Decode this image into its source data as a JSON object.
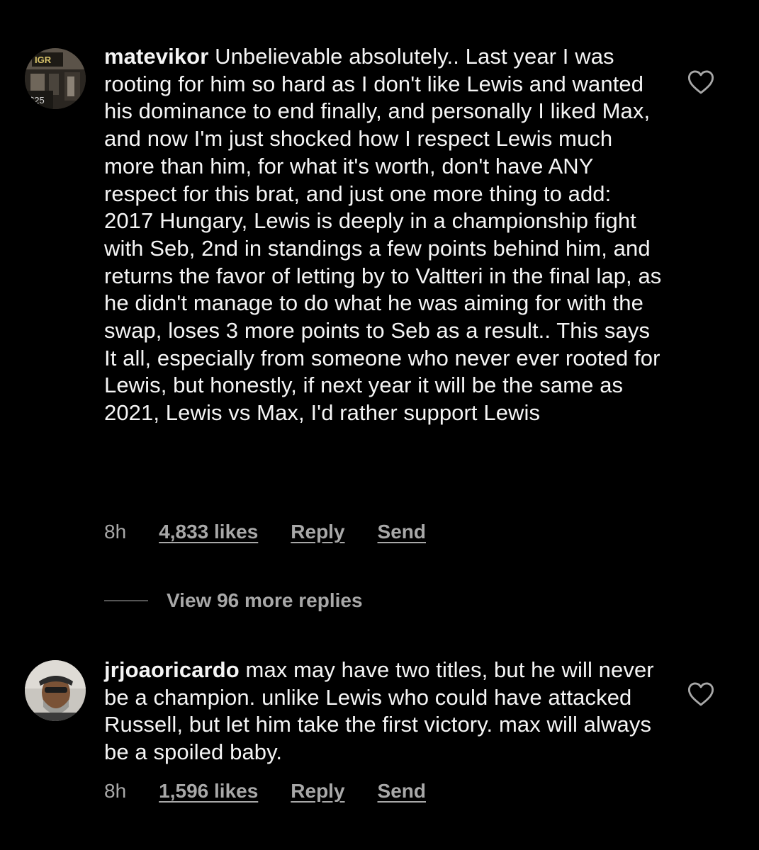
{
  "comments": [
    {
      "username": "matevikor",
      "text": "Unbelievable absolutely.. Last year I was rooting for him so hard as I don't like Lewis and wanted his dominance to end finally, and personally I liked Max, and now I'm just shocked how I respect Lewis much more than him, for what it's worth, don't have ANY respect for this brat, and just one more thing to add: 2017 Hungary, Lewis is deeply in a championship fight with Seb, 2nd in standings a few points behind him, and returns the favor of letting by to Valtteri in the final lap, as he didn't manage to do what he was aiming for with the swap, loses 3 more points to Seb as a result.. This says It all, especially from someone who never ever rooted for Lewis, but honestly, if next year it will be the same as 2021, Lewis vs Max, I'd rather support Lewis",
      "time": "8h",
      "likes": "4,833 likes",
      "reply_label": "Reply",
      "send_label": "Send",
      "avatar_sign_text": "IGR",
      "avatar_price_text": "$25"
    },
    {
      "username": "jrjoaoricardo",
      "text": "max may have two titles, but he will never be a champion.  unlike Lewis who could have attacked Russell, but let him take the first victory.  max will always be a spoiled baby.",
      "time": "8h",
      "likes": "1,596 likes",
      "reply_label": "Reply",
      "send_label": "Send"
    }
  ],
  "view_replies": {
    "label": "View 96 more replies"
  },
  "icons": {
    "like": "heart-outline-icon"
  },
  "colors": {
    "background": "#000000",
    "primary_text": "#f5f5f5",
    "secondary_text": "#a8a8a8"
  }
}
